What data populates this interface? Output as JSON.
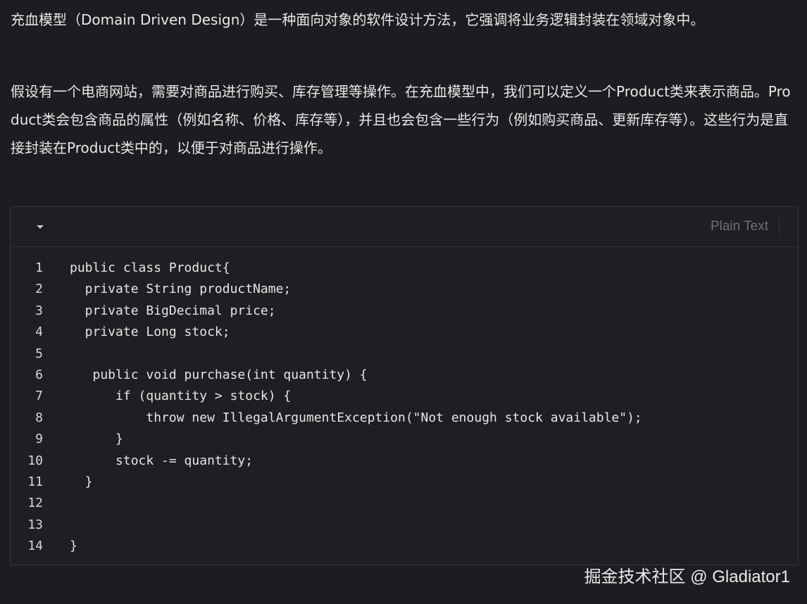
{
  "article": {
    "paragraph_1": "充血模型（Domain Driven Design）是一种面向对象的软件设计方法，它强调将业务逻辑封装在领域对象中。",
    "paragraph_2": "假设有一个电商网站，需要对商品进行购买、库存管理等操作。在充血模型中，我们可以定义一个Product类来表示商品。Product类会包含商品的属性（例如名称、价格、库存等），并且也会包含一些行为（例如购买商品、更新库存等）。这些行为是直接封装在Product类中的，以便于对商品进行操作。"
  },
  "code_block": {
    "language": "Plain Text",
    "collapse_icon": "caret-down-icon",
    "lines": [
      {
        "n": "1",
        "text": "public class Product{"
      },
      {
        "n": "2",
        "text": "  private String productName;"
      },
      {
        "n": "3",
        "text": "  private BigDecimal price;"
      },
      {
        "n": "4",
        "text": "  private Long stock;"
      },
      {
        "n": "5",
        "text": ""
      },
      {
        "n": "6",
        "text": "   public void purchase(int quantity) {"
      },
      {
        "n": "7",
        "text": "      if (quantity > stock) {"
      },
      {
        "n": "8",
        "text": "          throw new IllegalArgumentException(\"Not enough stock available\");"
      },
      {
        "n": "9",
        "text": "      }"
      },
      {
        "n": "10",
        "text": "      stock -= quantity;"
      },
      {
        "n": "11",
        "text": "  }"
      },
      {
        "n": "12",
        "text": ""
      },
      {
        "n": "13",
        "text": ""
      },
      {
        "n": "14",
        "text": "}"
      }
    ]
  },
  "watermark": "掘金技术社区 @ Gladiator1",
  "colors": {
    "background": "#1c1d20",
    "code_background": "#1e1f22",
    "border": "#34363b",
    "muted_text": "#6d6f74"
  }
}
